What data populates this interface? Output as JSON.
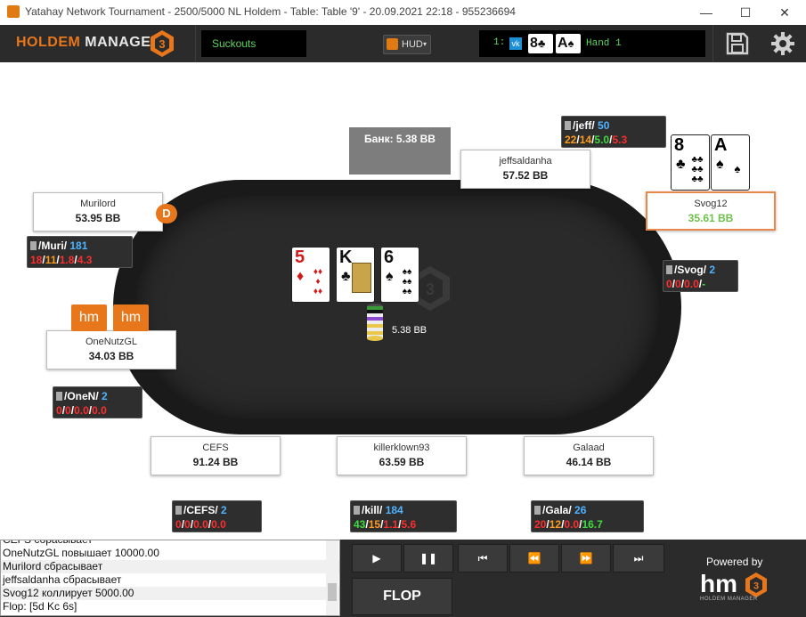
{
  "window": {
    "title": "Yatahay Network Tournament - 2500/5000 NL Holdem - Table: Table '9' - 20.09.2021 22:18 - 955236694",
    "minimize": "—",
    "maximize": "☐",
    "close": "✕"
  },
  "toolbar": {
    "logo_text_a": "HOLDEM",
    "logo_text_b": "MANAGER",
    "logo_badge": "3",
    "suckouts": "Suckouts",
    "hud_button": "HUD",
    "hand_number": "1:",
    "hand_cards": [
      {
        "rank": "8",
        "suit": "♣"
      },
      {
        "rank": "A",
        "suit": "♠"
      }
    ],
    "hand_label": "Hand 1"
  },
  "table": {
    "bank": "Банк: 5.38 BB",
    "pot_amount": "5.38 BB",
    "dealer": "D",
    "hm_badges": [
      "hm",
      "hm"
    ],
    "board": [
      {
        "rank": "5",
        "suit": "♦",
        "color": "#d11a1a"
      },
      {
        "rank": "K",
        "suit": "♣",
        "color": "#111111"
      },
      {
        "rank": "6",
        "suit": "♠",
        "color": "#111111"
      }
    ],
    "hero_cards": [
      {
        "rank": "8",
        "suit": "♣",
        "color": "#111111"
      },
      {
        "rank": "A",
        "suit": "♠",
        "color": "#111111"
      }
    ]
  },
  "players": {
    "jeffsaldanha": {
      "name": "jeffsaldanha",
      "stack": "57.52 BB"
    },
    "murilord": {
      "name": "Murilord",
      "stack": "53.95 BB"
    },
    "svog12": {
      "name": "Svog12",
      "stack": "35.61 BB"
    },
    "onenutzgl": {
      "name": "OneNutzGL",
      "stack": "34.03 BB"
    },
    "cefs": {
      "name": "CEFS",
      "stack": "91.24 BB"
    },
    "killerklown93": {
      "name": "killerklown93",
      "stack": "63.59 BB"
    },
    "galaad": {
      "name": "Galaad",
      "stack": "46.14 BB"
    }
  },
  "huds": {
    "jeff": {
      "name": "jeff",
      "hands": "50",
      "vpip": "22",
      "pfr": "14",
      "af": "5.0",
      "x": "5.3"
    },
    "muri": {
      "name": "Muri",
      "hands": "181",
      "vpip": "18",
      "pfr": "11",
      "af": "1.8",
      "x": "4.3"
    },
    "svog": {
      "name": "Svog",
      "hands": "2",
      "vpip": "0",
      "pfr": "0",
      "af": "0.0",
      "x": "-"
    },
    "onen": {
      "name": "OneN",
      "hands": "2",
      "vpip": "0",
      "pfr": "0",
      "af": "0.0",
      "x": "0.0"
    },
    "cefs": {
      "name": "CEFS",
      "hands": "2",
      "vpip": "0",
      "pfr": "0",
      "af": "0.0",
      "x": "0.0"
    },
    "kill": {
      "name": "kill",
      "hands": "184",
      "vpip": "43",
      "pfr": "15",
      "af": "1.1",
      "x": "5.6"
    },
    "gala": {
      "name": "Gala",
      "hands": "26",
      "vpip": "20",
      "pfr": "12",
      "af": "0.0",
      "x": "16.7"
    }
  },
  "log": [
    "CEFS сбрасывает",
    "OneNutzGL повышает 10000.00",
    "Murilord сбрасывает",
    "jeffsaldanha сбрасывает",
    "Svog12 коллирует 5000.00",
    "Flop: [5d Kc 6s]"
  ],
  "controls": {
    "play": "▶",
    "pause": "❚❚",
    "first": "⏮",
    "prev": "⏪",
    "next": "⏩",
    "last": "⏭",
    "street": "FLOP"
  },
  "footer": {
    "powered_by": "Powered by",
    "brand": "hm",
    "brand_badge": "3",
    "brand_sub": "HOLDEM MANAGER"
  },
  "colors": {
    "accent": "#e8761b",
    "toolbar_bg": "#2b2b2b",
    "stat_blue": "#4fb3ff",
    "stat_red": "#ff2d2d",
    "stat_orange": "#ff9a1a",
    "stat_green": "#3ddc3d"
  }
}
